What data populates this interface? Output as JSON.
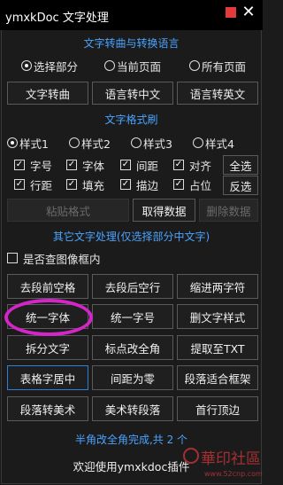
{
  "window": {
    "title": "ymxkDoc  文字处理",
    "close_glyph": "✕"
  },
  "sections": {
    "translate": "文字转曲与转换语言",
    "format_brush": "文字格式刷",
    "other": "其它文字处理(仅选择部分中文字)"
  },
  "scope_options": [
    {
      "label": "选择部分",
      "selected": true
    },
    {
      "label": "当前页面",
      "selected": false
    },
    {
      "label": "所有页面",
      "selected": false
    }
  ],
  "translate_buttons": [
    "文字转曲",
    "语言转中文",
    "语言转英文"
  ],
  "style_options": [
    {
      "label": "样式1",
      "selected": true
    },
    {
      "label": "样式2",
      "selected": false
    },
    {
      "label": "样式3",
      "selected": false
    },
    {
      "label": "样式4",
      "selected": false
    }
  ],
  "format_checks_row1": [
    {
      "label": "字号",
      "checked": true
    },
    {
      "label": "字体",
      "checked": true
    },
    {
      "label": "间距",
      "checked": true
    },
    {
      "label": "对齐",
      "checked": true
    }
  ],
  "format_checks_row2": [
    {
      "label": "行距",
      "checked": true
    },
    {
      "label": "填充",
      "checked": true
    },
    {
      "label": "描边",
      "checked": true
    },
    {
      "label": "占位",
      "checked": true
    }
  ],
  "select_all": "全选",
  "invert_select": "反选",
  "paste_format": "粘贴格式",
  "get_data": "取得数据",
  "delete_data": "删除数据",
  "image_frame_check": {
    "label": "是否查图像框内",
    "checked": false
  },
  "tools": [
    [
      "去段前空格",
      "去段后空行",
      "缩进两字符"
    ],
    [
      "统一字体",
      "统一字号",
      "删文字样式"
    ],
    [
      "拆分文字",
      "标点改全角",
      "提取至TXT"
    ],
    [
      "表格字居中",
      "间距为零",
      "段落适合框架"
    ],
    [
      "段落转美术",
      "美术转段落",
      "首行顶边"
    ]
  ],
  "result_text": "半角改全角完成,共 2 个",
  "status_text": "欢迎使用ymxkdoc插件",
  "watermark": {
    "text": "華印社區",
    "url": "www.52cnp.com"
  },
  "colors": {
    "accent": "#4aa3ff",
    "highlight_oval": "#d425c9",
    "pin": "#e23b3b"
  }
}
